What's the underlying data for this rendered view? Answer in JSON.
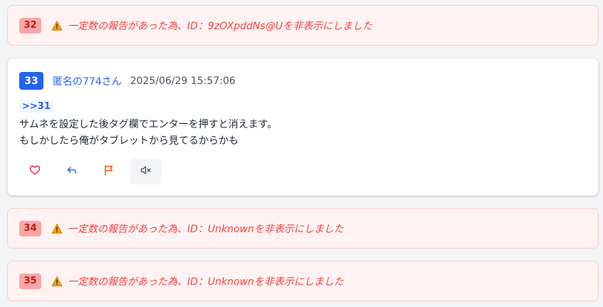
{
  "hidden_posts": [
    {
      "number": "32",
      "message": "一定数の報告があった為、ID：9zOXpddNs@Uを非表示にしました"
    },
    {
      "number": "34",
      "message": "一定数の報告があった為、ID：Unknownを非表示にしました"
    },
    {
      "number": "35",
      "message": "一定数の報告があった為、ID：Unknownを非表示にしました"
    }
  ],
  "post": {
    "number": "33",
    "author": "匿名の774さん",
    "date": "2025/06/29 15:57:06",
    "reply_ref": ">>31",
    "lines": [
      "サムネを設定した後タグ欄でエンターを押すと消えます。",
      "もしかしたら俺がタブレットから見てるからかも"
    ],
    "actions": [
      "heart-icon",
      "reply-icon",
      "flag-icon",
      "mute-icon"
    ]
  },
  "colors": {
    "accent": "#2563eb",
    "warning_text": "#ef4444",
    "warning_bg": "#fef2f2",
    "badge_red": "#fca5a5"
  }
}
